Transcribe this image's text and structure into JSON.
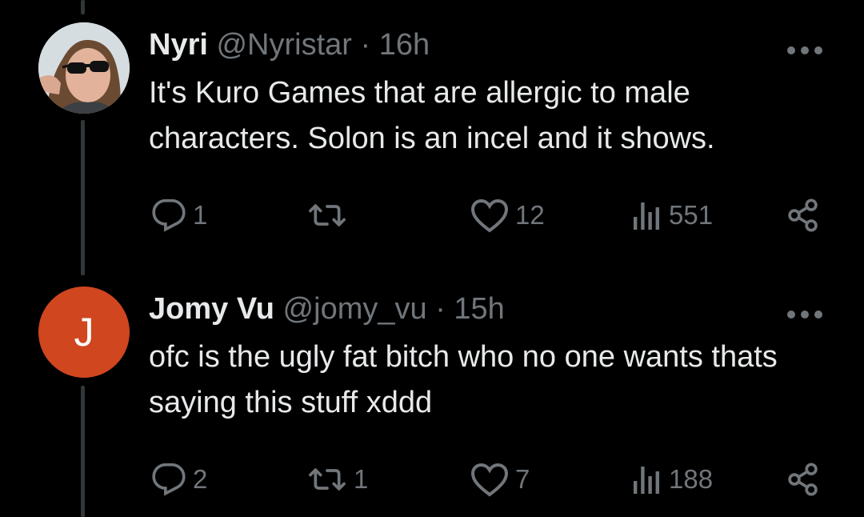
{
  "tweets": [
    {
      "name": "Nyri",
      "handle": "@Nyristar",
      "separator": "·",
      "time": "16h",
      "text": "It's Kuro Games that are allergic to male characters. Solon is an incel and it shows.",
      "avatar": {
        "type": "photo",
        "letter": ""
      },
      "replies": "1",
      "reposts": "",
      "likes": "12",
      "views": "551"
    },
    {
      "name": "Jomy Vu",
      "handle": "@jomy_vu",
      "separator": "·",
      "time": "15h",
      "text": "ofc is the ugly fat bitch who no one wants thats saying this stuff xddd",
      "avatar": {
        "type": "letter",
        "letter": "J",
        "color": "#d0461f"
      },
      "replies": "2",
      "reposts": "1",
      "likes": "7",
      "views": "188"
    }
  ],
  "colors": {
    "background": "#000000",
    "primary_text": "#e7e9ea",
    "secondary_text": "#71767b",
    "thread_line": "#333639"
  },
  "icons": [
    "more-icon",
    "reply-icon",
    "repost-icon",
    "like-icon",
    "views-icon",
    "share-icon"
  ]
}
